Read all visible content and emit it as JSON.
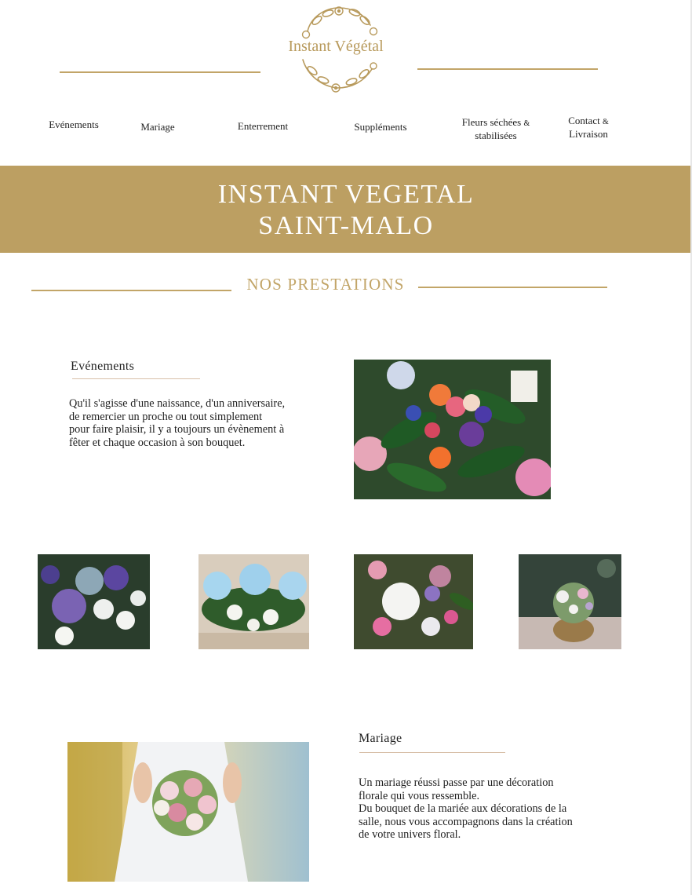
{
  "logo": {
    "text": "Instant Végétal"
  },
  "nav": [
    {
      "label": "Evénements"
    },
    {
      "label": "Mariage"
    },
    {
      "label": "Enterrement"
    },
    {
      "label": "Suppléments"
    },
    {
      "line1": "Fleurs séchées",
      "amp": "&",
      "line2": "stabilisées"
    },
    {
      "line1": "Contact",
      "amp": "&",
      "line2": "Livraison"
    }
  ],
  "banner": {
    "line1": "INSTANT VEGETAL",
    "line2": "SAINT-MALO"
  },
  "section": {
    "title": "NOS PRESTATIONS"
  },
  "evenements": {
    "heading": "Evénements",
    "lines": [
      "Qu'il s'agisse d'une naissance, d'un anniversaire,",
      "de remercier un proche ou tout simplement",
      "pour faire plaisir, il y a toujours un évènement à",
      "fêter et chaque occasion à son bouquet."
    ]
  },
  "mariage": {
    "heading": "Mariage",
    "lines": [
      "Un mariage réussi passe par une décoration",
      "florale qui vous ressemble.",
      "Du bouquet de la mariée aux décorations de la",
      "salle, nous vous accompagnons dans la création",
      "de votre univers floral."
    ]
  },
  "colors": {
    "gold": "#bc9f62",
    "logo": "#b89a5c",
    "text": "#1f1f1f"
  }
}
